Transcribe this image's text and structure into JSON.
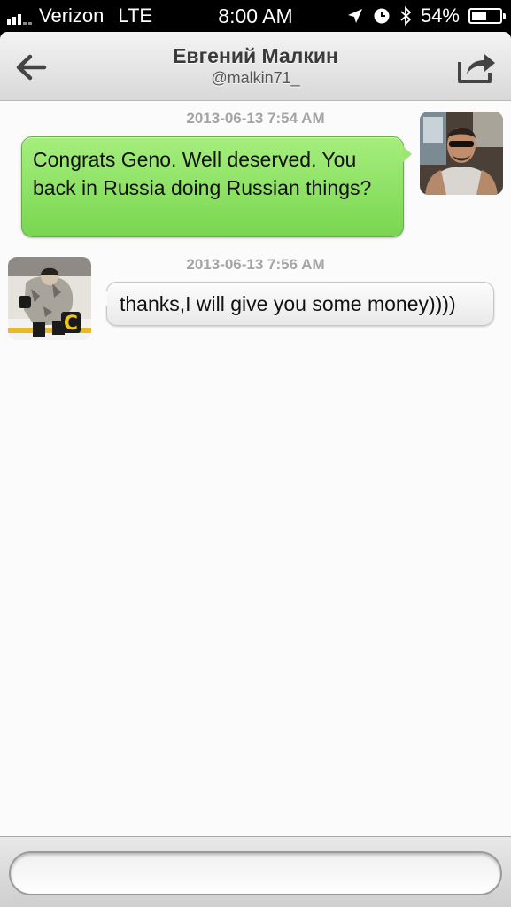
{
  "status_bar": {
    "carrier": "Verizon",
    "network": "LTE",
    "time": "8:00 AM",
    "battery": "54%",
    "battery_level": 0.54,
    "signal_bars": 3
  },
  "header": {
    "title": "Евгений Малкин",
    "subtitle": "@malkin71_",
    "back_icon": "back-arrow-icon",
    "share_icon": "share-icon"
  },
  "conversation": {
    "messages": [
      {
        "timestamp": "2013-06-13 7:54 AM",
        "direction": "outgoing",
        "text": "Congrats Geno. Well deserved. You back in Russia doing Russian things?"
      },
      {
        "timestamp": "2013-06-13 7:56 AM",
        "direction": "incoming",
        "text": "thanks,I will give you some money))))"
      }
    ]
  },
  "compose": {
    "placeholder": "",
    "value": ""
  },
  "colors": {
    "outgoing_bubble": "#8be060",
    "incoming_bubble": "#f4f4f4",
    "timestamp": "#a4a4a4"
  }
}
